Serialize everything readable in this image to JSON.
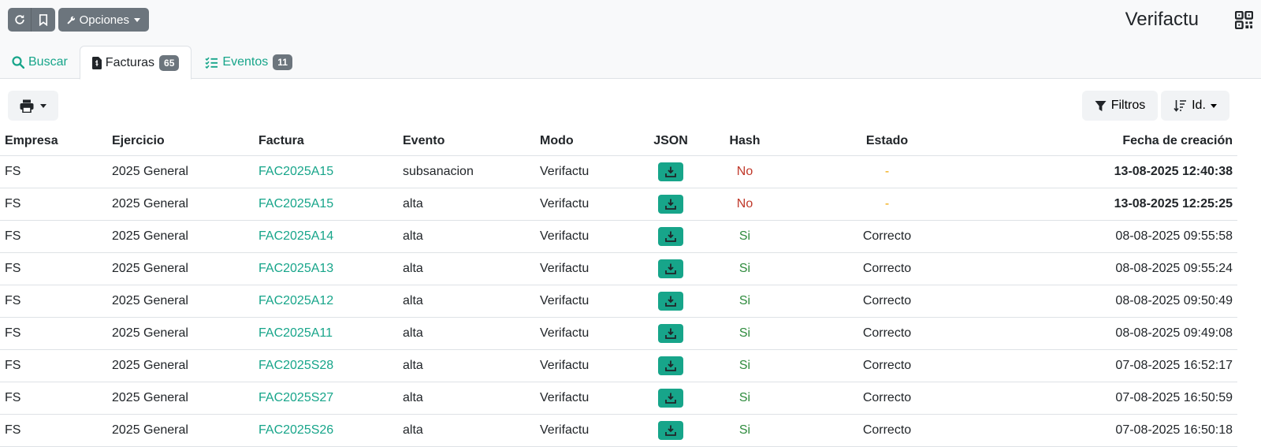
{
  "header": {
    "title": "Verifactu",
    "options_label": "Opciones"
  },
  "tabs": [
    {
      "label": "Buscar"
    },
    {
      "label": "Facturas",
      "count": "65"
    },
    {
      "label": "Eventos",
      "count": "11"
    }
  ],
  "toolbar": {
    "filters_label": "Filtros",
    "sort_label": "Id."
  },
  "table": {
    "columns": [
      "Empresa",
      "Ejercicio",
      "Factura",
      "Evento",
      "Modo",
      "JSON",
      "Hash",
      "Estado",
      "Fecha de creación"
    ],
    "rows": [
      {
        "empresa": "FS",
        "ejercicio": "2025 General",
        "factura": "FAC2025A15",
        "evento": "subsanacion",
        "modo": "Verifactu",
        "hash": "No",
        "estado": "-",
        "fecha": "13-08-2025 12:40:38"
      },
      {
        "empresa": "FS",
        "ejercicio": "2025 General",
        "factura": "FAC2025A15",
        "evento": "alta",
        "modo": "Verifactu",
        "hash": "No",
        "estado": "-",
        "fecha": "13-08-2025 12:25:25"
      },
      {
        "empresa": "FS",
        "ejercicio": "2025 General",
        "factura": "FAC2025A14",
        "evento": "alta",
        "modo": "Verifactu",
        "hash": "Si",
        "estado": "Correcto",
        "fecha": "08-08-2025 09:55:58"
      },
      {
        "empresa": "FS",
        "ejercicio": "2025 General",
        "factura": "FAC2025A13",
        "evento": "alta",
        "modo": "Verifactu",
        "hash": "Si",
        "estado": "Correcto",
        "fecha": "08-08-2025 09:55:24"
      },
      {
        "empresa": "FS",
        "ejercicio": "2025 General",
        "factura": "FAC2025A12",
        "evento": "alta",
        "modo": "Verifactu",
        "hash": "Si",
        "estado": "Correcto",
        "fecha": "08-08-2025 09:50:49"
      },
      {
        "empresa": "FS",
        "ejercicio": "2025 General",
        "factura": "FAC2025A11",
        "evento": "alta",
        "modo": "Verifactu",
        "hash": "Si",
        "estado": "Correcto",
        "fecha": "08-08-2025 09:49:08"
      },
      {
        "empresa": "FS",
        "ejercicio": "2025 General",
        "factura": "FAC2025S28",
        "evento": "alta",
        "modo": "Verifactu",
        "hash": "Si",
        "estado": "Correcto",
        "fecha": "07-08-2025 16:52:17"
      },
      {
        "empresa": "FS",
        "ejercicio": "2025 General",
        "factura": "FAC2025S27",
        "evento": "alta",
        "modo": "Verifactu",
        "hash": "Si",
        "estado": "Correcto",
        "fecha": "07-08-2025 16:50:59"
      },
      {
        "empresa": "FS",
        "ejercicio": "2025 General",
        "factura": "FAC2025S26",
        "evento": "alta",
        "modo": "Verifactu",
        "hash": "Si",
        "estado": "Correcto",
        "fecha": "07-08-2025 16:50:18"
      }
    ]
  },
  "colors": {
    "accent": "#17a58a",
    "no": "#c0392b",
    "si": "#2e8b3d",
    "pending": "#f0a500"
  }
}
